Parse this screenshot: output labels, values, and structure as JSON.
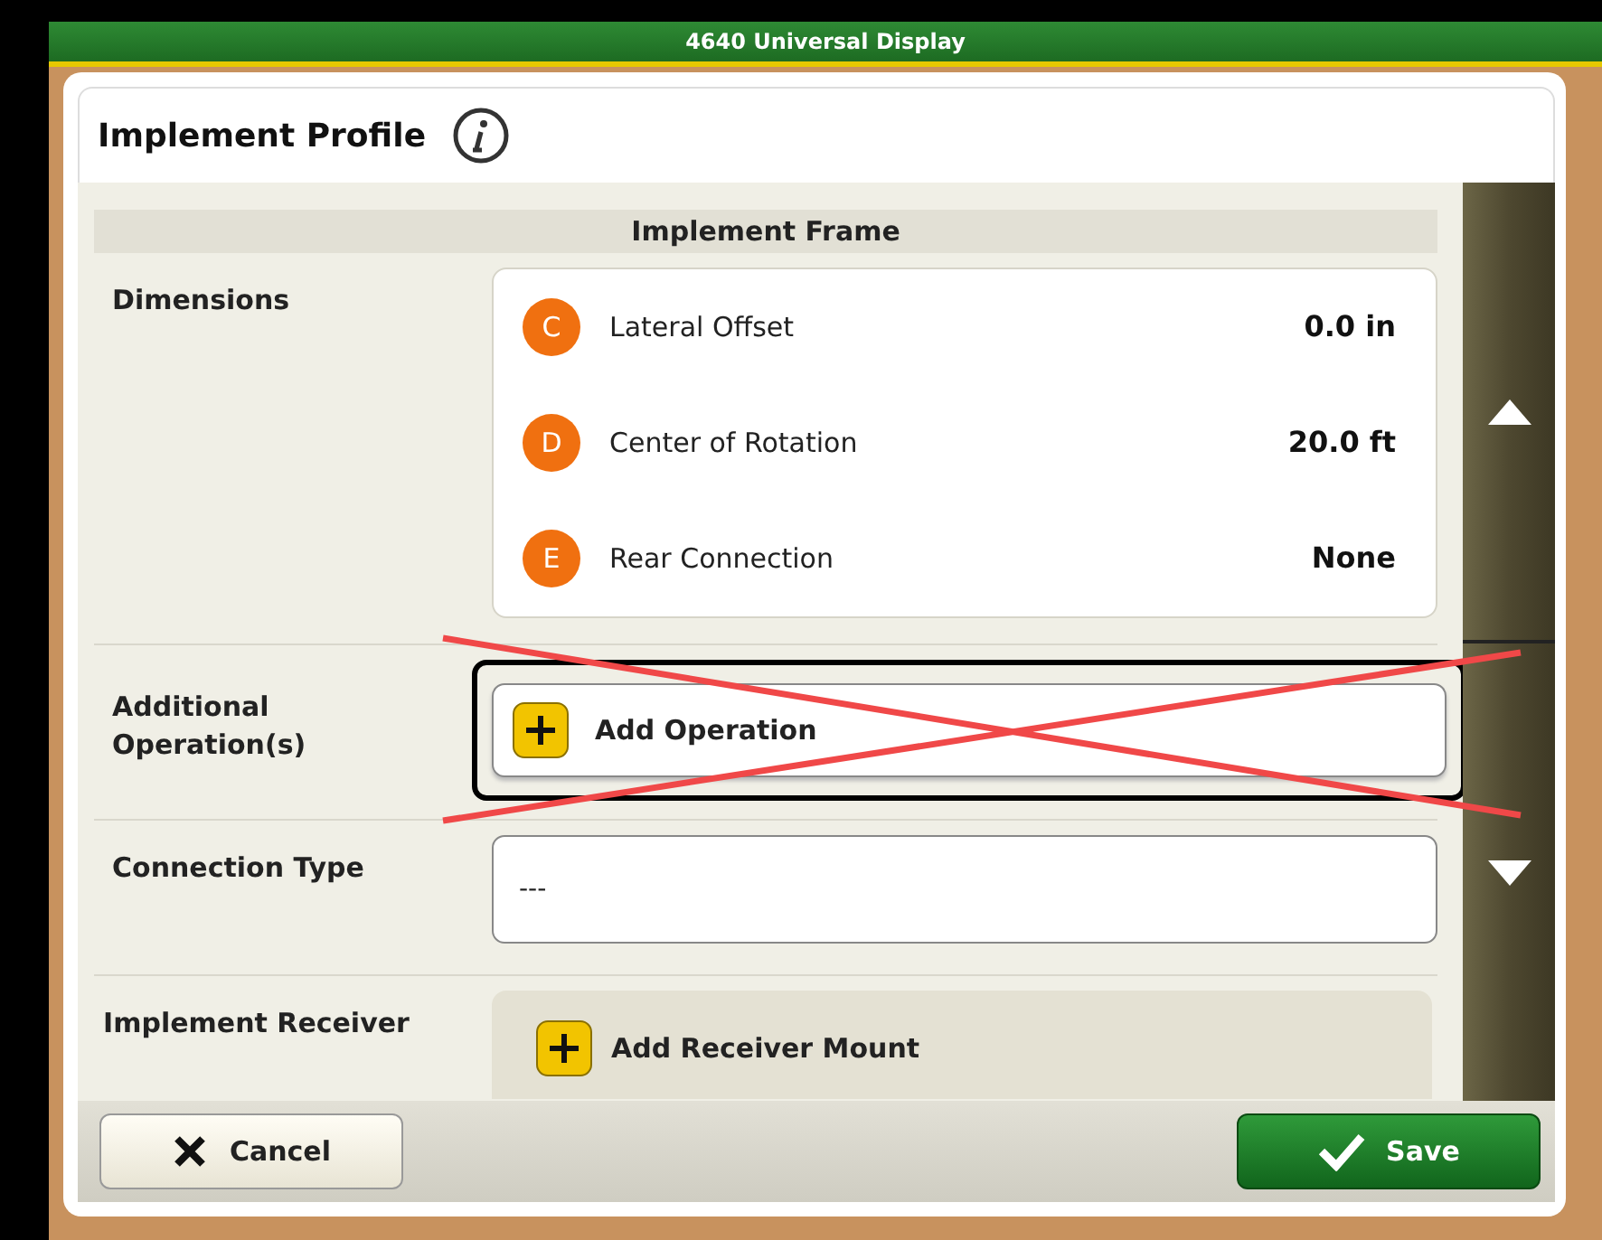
{
  "window": {
    "title": "4640 Universal Display"
  },
  "page": {
    "title": "Implement Profile"
  },
  "section": {
    "title": "Implement Frame"
  },
  "dimensions": {
    "label": "Dimensions",
    "items": [
      {
        "letter": "C",
        "name": "Lateral Offset",
        "value": "0.0 in"
      },
      {
        "letter": "D",
        "name": "Center of Rotation",
        "value": "20.0 ft"
      },
      {
        "letter": "E",
        "name": "Rear Connection",
        "value": "None"
      }
    ]
  },
  "additional_operations": {
    "label": "Additional Operation(s)",
    "button": "Add Operation",
    "crossed_out": true
  },
  "connection_type": {
    "label": "Connection Type",
    "value": "---"
  },
  "implement_receiver": {
    "label": "Implement Receiver",
    "button": "Add Receiver Mount"
  },
  "footer": {
    "cancel": "Cancel",
    "save": "Save"
  }
}
